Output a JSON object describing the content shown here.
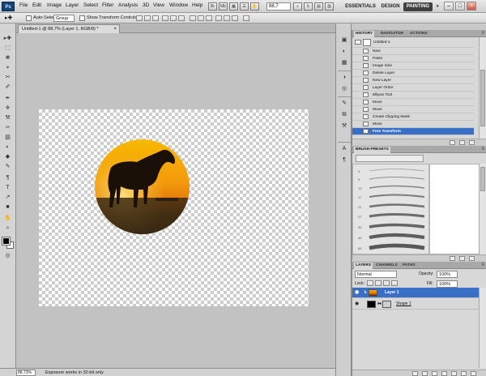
{
  "app": {
    "logo": "Ps"
  },
  "menu": [
    "File",
    "Edit",
    "Image",
    "Layer",
    "Select",
    "Filter",
    "Analysis",
    "3D",
    "View",
    "Window",
    "Help"
  ],
  "menubar_icons": [
    "Br",
    "Mb",
    "▦",
    "☰",
    "✋",
    "⌕",
    "↻",
    "▤",
    "▥"
  ],
  "zoom_readout": "88,7",
  "workspaces": {
    "essentials": "ESSENTIALS",
    "design": "DESIGN",
    "painting": "PAINTING",
    "more": "»"
  },
  "window_controls": {
    "minimize": "–",
    "restore": "□",
    "close": "×"
  },
  "options_bar": {
    "tool": "▸✚",
    "auto_select_label": "Auto-Select:",
    "auto_select_value": "Group",
    "show_transform_label": "Show Transform Controls"
  },
  "document_tab": {
    "title": "Untitled-1 @ 88,7% (Layer 1, RGB/8) *",
    "close": "×"
  },
  "tools": [
    "▸✚",
    "⬚",
    "❀",
    "⌖",
    "✂",
    "✐",
    "✒",
    "❈",
    "⚒",
    "✑",
    "▧",
    "◐",
    "◆",
    "✎",
    "¶",
    "T",
    "↗",
    "■",
    "✋",
    "⌕",
    "☆",
    "↺",
    "◎"
  ],
  "status_bar": {
    "zoom": "88,73%",
    "info": "Exposure works in 32-bit only"
  },
  "history": {
    "tabs": [
      "HISTORY",
      "NAVIGATOR",
      "ACTIONS"
    ],
    "snapshot": "Untitled-1",
    "items": [
      "New",
      "Paste",
      "Image Size",
      "Delete Layer",
      "New Layer",
      "Layer Order",
      "Ellipse Tool",
      "Move",
      "Move",
      "Create Clipping Mask",
      "Move",
      "Free Transform"
    ]
  },
  "brush_presets": {
    "tabs": [
      "BRUSH PRESETS"
    ],
    "sizes": [
      "5",
      "9",
      "13",
      "17",
      "21",
      "27",
      "35",
      "45",
      "65"
    ]
  },
  "layers": {
    "tabs": [
      "LAYERS",
      "CHANNELS",
      "PATHS"
    ],
    "blend_mode": "Normal",
    "opacity_label": "Opacity:",
    "opacity_value": "100%",
    "lock_label": "Lock:",
    "fill_label": "Fill:",
    "fill_value": "100%",
    "items": [
      {
        "name": "Layer 1",
        "selected": true
      },
      {
        "name": "Shape 1",
        "selected": false
      }
    ]
  },
  "colors": {
    "selection": "#3a6fc8",
    "canvas_bg": "#c2c2c2",
    "panel_bg": "#d8d8d8"
  }
}
